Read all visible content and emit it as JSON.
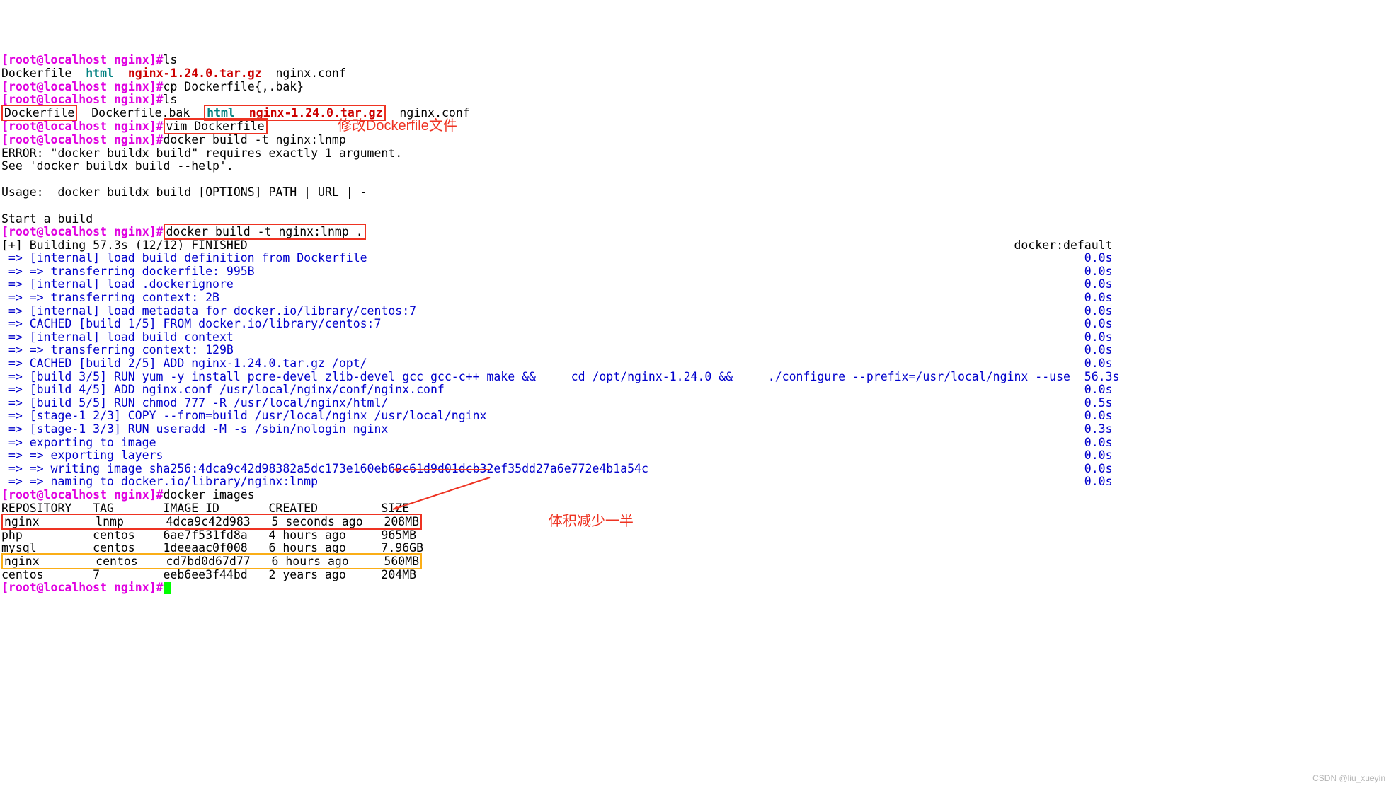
{
  "prompt": {
    "user": "root",
    "host": "localhost",
    "dir": "nginx",
    "sep": "]#"
  },
  "lines": {
    "cmd_ls1": "ls",
    "ls1_out": {
      "file": "Dockerfile",
      "html": "html",
      "tar": "nginx-1.24.0.tar.gz",
      "conf": "nginx.conf"
    },
    "cmd_cp": "cp Dockerfile{,.bak}",
    "cmd_ls2": "ls",
    "ls2_out": {
      "file": "Dockerfile",
      "bak": "Dockerfile.bak",
      "html": "html",
      "tar": "nginx-1.24.0.tar.gz",
      "conf": "nginx.conf"
    },
    "cmd_vim": "vim Dockerfile",
    "annot_vim": "修改Dockerfile文件",
    "cmd_build1": "docker build -t nginx:lnmp",
    "err1": "ERROR: \"docker buildx build\" requires exactly 1 argument.",
    "err2": "See 'docker buildx build --help'.",
    "usage": "Usage:  docker buildx build [OPTIONS] PATH | URL | -",
    "start": "Start a build",
    "cmd_build2": "docker build -t nginx:lnmp .",
    "building_left": "[+] Building 57.3s (12/12) FINISHED",
    "building_right": "docker:default",
    "steps": [
      {
        "t": " => [internal] load build definition from Dockerfile",
        "d": "0.0s"
      },
      {
        "t": " => => transferring dockerfile: 995B",
        "d": "0.0s"
      },
      {
        "t": " => [internal] load .dockerignore",
        "d": "0.0s"
      },
      {
        "t": " => => transferring context: 2B",
        "d": "0.0s"
      },
      {
        "t": " => [internal] load metadata for docker.io/library/centos:7",
        "d": "0.0s"
      },
      {
        "t": " => CACHED [build 1/5] FROM docker.io/library/centos:7",
        "d": "0.0s"
      },
      {
        "t": " => [internal] load build context",
        "d": "0.0s"
      },
      {
        "t": " => => transferring context: 129B",
        "d": "0.0s"
      },
      {
        "t": " => CACHED [build 2/5] ADD nginx-1.24.0.tar.gz /opt/",
        "d": "0.0s"
      },
      {
        "t": " => [build 3/5] RUN yum -y install pcre-devel zlib-devel gcc gcc-c++ make &&     cd /opt/nginx-1.24.0 &&     ./configure --prefix=/usr/local/nginx --use",
        "d": "56.3s"
      },
      {
        "t": " => [build 4/5] ADD nginx.conf /usr/local/nginx/conf/nginx.conf",
        "d": "0.0s"
      },
      {
        "t": " => [build 5/5] RUN chmod 777 -R /usr/local/nginx/html/",
        "d": "0.5s"
      },
      {
        "t": " => [stage-1 2/3] COPY --from=build /usr/local/nginx /usr/local/nginx",
        "d": "0.0s"
      },
      {
        "t": " => [stage-1 3/3] RUN useradd -M -s /sbin/nologin nginx",
        "d": "0.3s"
      },
      {
        "t": " => exporting to image",
        "d": "0.0s"
      },
      {
        "t": " => => exporting layers",
        "d": "0.0s"
      },
      {
        "t": " => => writing image sha256:4dca9c42d98382a5dc173e160eb69c61d9d01dcb32ef35dd27a6e772e4b1a54c",
        "d": "0.0s"
      },
      {
        "t": " => => naming to docker.io/library/nginx:lnmp",
        "d": "0.0s"
      }
    ],
    "cmd_images": "docker images",
    "images_header": "REPOSITORY   TAG       IMAGE ID       CREATED         SIZE  ",
    "images": [
      "nginx        lnmp      4dca9c42d983   5 seconds ago   208MB",
      "php          centos    6ae7f531fd8a   4 hours ago     965MB",
      "mysql        centos    1deeaac0f008   6 hours ago     7.96GB",
      "nginx        centos    cd7bd0d67d77   6 hours ago     560MB",
      "centos       7         eeb6ee3f44bd   2 years ago     204MB"
    ],
    "annot_size": "体积减少一半"
  },
  "watermark": "CSDN @liu_xueyin"
}
